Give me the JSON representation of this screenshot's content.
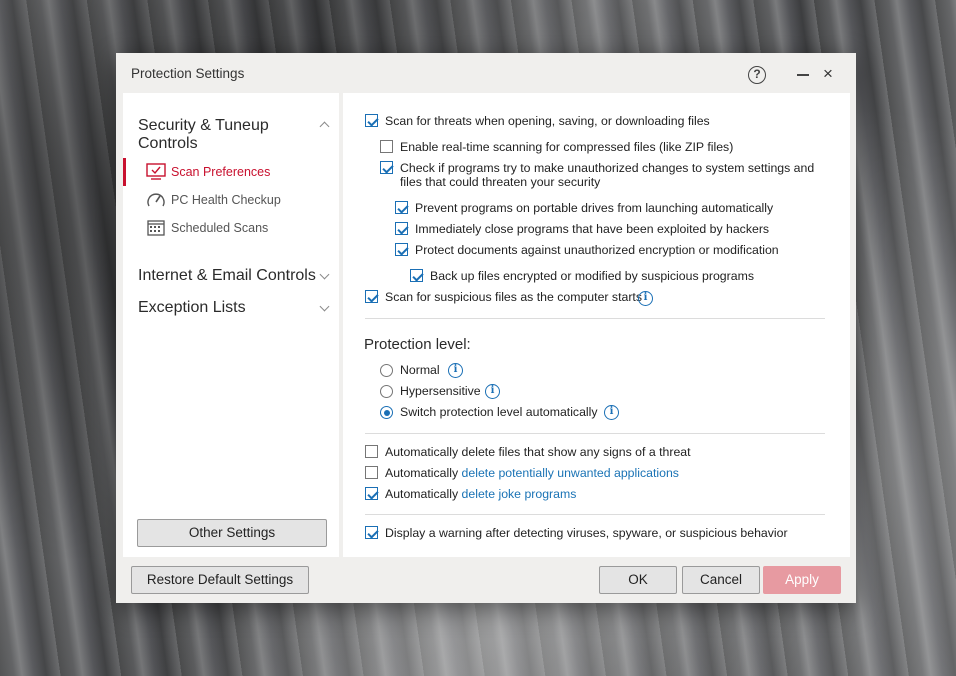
{
  "window": {
    "title": "Protection Settings",
    "help_glyph": "?",
    "close_glyph": "×"
  },
  "sidebar": {
    "group1": {
      "label": "Security & Tuneup Controls",
      "expanded": true
    },
    "items": [
      {
        "label": "Scan Preferences",
        "icon": "monitor-check-icon",
        "active": true
      },
      {
        "label": "PC Health Checkup",
        "icon": "gauge-icon",
        "active": false
      },
      {
        "label": "Scheduled Scans",
        "icon": "calendar-icon",
        "active": false
      }
    ],
    "group2": {
      "label": "Internet & Email Controls",
      "expanded": false
    },
    "group3": {
      "label": "Exception Lists",
      "expanded": false
    },
    "other_settings_button": "Other Settings"
  },
  "options": {
    "scan_threats": {
      "label": "Scan for threats when opening, saving, or downloading files",
      "checked": true
    },
    "realtime_zip": {
      "label": "Enable real-time scanning for compressed files (like ZIP files)",
      "checked": false
    },
    "check_programs": {
      "line1": "Check if programs try to make unauthorized changes to system settings and",
      "line2": "files that could threaten your security",
      "checked": true
    },
    "prevent_portable": {
      "label": "Prevent programs on portable drives from launching automatically",
      "checked": true
    },
    "close_exploited": {
      "label": "Immediately close programs that have been exploited by hackers",
      "checked": true
    },
    "protect_docs": {
      "label": "Protect documents against unauthorized encryption or modification",
      "checked": true
    },
    "backup_files": {
      "label": "Back up files encrypted or modified by suspicious programs",
      "checked": true
    },
    "scan_startup": {
      "label": "Scan for suspicious files as the computer starts",
      "checked": true
    }
  },
  "protection_level": {
    "title": "Protection level:",
    "normal": {
      "label": "Normal",
      "selected": false
    },
    "hypersensitive": {
      "label": "Hypersensitive",
      "selected": false
    },
    "auto": {
      "label": "Switch protection level automatically",
      "selected": true
    }
  },
  "delete_options": {
    "threat_files": {
      "label": "Automatically delete files that show any signs of a threat",
      "checked": false
    },
    "pua": {
      "prefix": "Automatically ",
      "link": "delete potentially unwanted applications",
      "checked": false
    },
    "joke": {
      "prefix": "Automatically ",
      "link": "delete joke programs",
      "checked": true
    }
  },
  "warning_option": {
    "label": "Display a warning after detecting viruses, spyware, or suspicious behavior",
    "checked": true
  },
  "footer": {
    "restore_defaults": "Restore Default Settings",
    "ok": "OK",
    "cancel": "Cancel",
    "apply": "Apply"
  },
  "colors": {
    "accent_red": "#c8102e",
    "link_blue": "#1a73b5",
    "apply_disabled": "#e79aa1"
  },
  "info_glyph": "i"
}
